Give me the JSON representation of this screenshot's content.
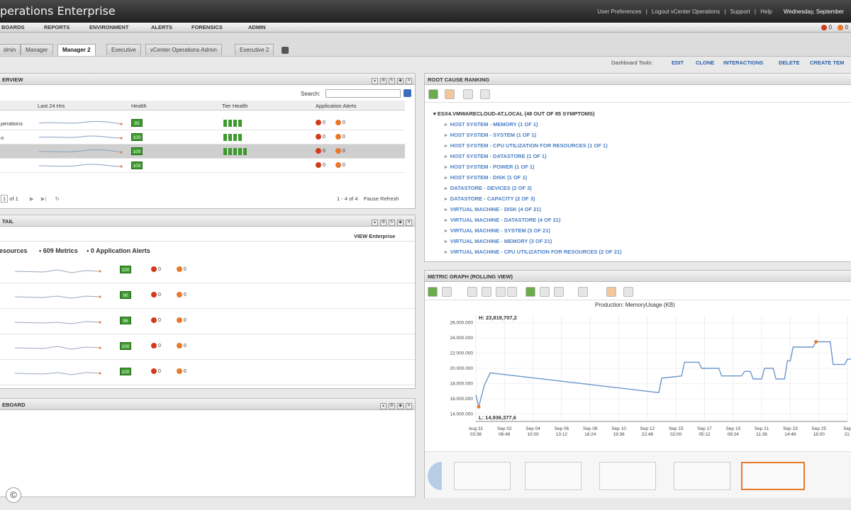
{
  "app_title": "perations Enterprise",
  "top_links": [
    "User Preferences",
    "|",
    "Logout vCenter Operations",
    "|",
    "Support",
    "|",
    "Help"
  ],
  "date_text": "Wednesday, September",
  "menu": [
    "BOARDS",
    "REPORTS",
    "ENVIRONMENT",
    "ALERTS",
    "FORENSICS",
    "ADMIN"
  ],
  "alert_counts": {
    "red": "0",
    "orange": "0"
  },
  "tabs": [
    {
      "label": "dmin",
      "active": false
    },
    {
      "label": "Manager",
      "active": false
    },
    {
      "label": "Manager 2",
      "active": true
    },
    {
      "label": "Executive",
      "active": false
    },
    {
      "label": "vCenter Operations Admin",
      "active": false
    },
    {
      "label": "Executive 2",
      "active": false
    }
  ],
  "dashboard_tools": {
    "label": "Dashboard Tools:",
    "links": [
      "EDIT",
      "CLONE",
      "INTERACTIONS",
      "DELETE",
      "CREATE TEM"
    ]
  },
  "overview": {
    "title": "ERVIEW",
    "search_label": "Search:",
    "search_value": "",
    "columns": [
      "Last 24 Hrs",
      "Health",
      "Tier Health",
      "Application Alerts"
    ],
    "rows": [
      {
        "name": "perations",
        "health": "93",
        "tiers": 4,
        "red": "0",
        "orange": "0",
        "selected": false
      },
      {
        "name": "o",
        "health": "100",
        "tiers": 4,
        "red": "0",
        "orange": "0",
        "selected": false
      },
      {
        "name": "",
        "health": "100",
        "tiers": 5,
        "red": "0",
        "orange": "0",
        "selected": true
      },
      {
        "name": "",
        "health": "100",
        "tiers": 0,
        "red": "0",
        "orange": "0",
        "selected": false
      }
    ],
    "pager": {
      "page": "1",
      "of": "of 1",
      "range": "1 - 4 of 4",
      "pause": "Pause Refresh"
    }
  },
  "detail": {
    "title": "TAIL",
    "subtitle": "VIEW Enterprise",
    "summary": [
      "esources",
      "• 609 Metrics",
      "• 0 Application Alerts"
    ],
    "rows": [
      {
        "health": "100",
        "red": "0",
        "orange": "0"
      },
      {
        "health": "90",
        "red": "0",
        "orange": "0"
      },
      {
        "health": "96",
        "red": "0",
        "orange": "0"
      },
      {
        "health": "100",
        "red": "0",
        "orange": "0"
      },
      {
        "health": "100",
        "red": "0",
        "orange": "0"
      }
    ]
  },
  "scoreboard": {
    "title": "EBOARD"
  },
  "root_cause": {
    "title": "ROOT CAUSE RANKING",
    "root": "ESX4.VMWARECLOUD-AT.LOCAL   (48 OUT OF 85 SYMPTOMS)",
    "symptoms": [
      "HOST SYSTEM - MEMORY   (1 OF 1)",
      "HOST SYSTEM - SYSTEM   (1 OF 1)",
      "HOST SYSTEM - CPU UTILIZATION FOR RESOURCES   (1 OF 1)",
      "HOST SYSTEM - DATASTORE   (1 OF 1)",
      "HOST SYSTEM - POWER   (1 OF 1)",
      "HOST SYSTEM - DISK   (1 OF 1)",
      "DATASTORE - DEVICES   (2 OF 3)",
      "DATASTORE - CAPACITY   (2 OF 3)",
      "VIRTUAL MACHINE - DISK   (4 OF 21)",
      "VIRTUAL MACHINE - DATASTORE   (4 OF 21)",
      "VIRTUAL MACHINE - SYSTEM   (3 OF 21)",
      "VIRTUAL MACHINE - MEMORY   (3 OF 21)",
      "VIRTUAL MACHINE - CPU UTILIZATION FOR RESOURCES   (2 OF 21)"
    ]
  },
  "metric_graph": {
    "title": "METRIC GRAPH (ROLLING VIEW)",
    "chart_title": "Production: MemoryUsage (KB)",
    "max_label": "H: 23,819,707,2",
    "min_label": "L: 14,936,377,6"
  },
  "chart_data": {
    "type": "line",
    "title": "Production: MemoryUsage (KB)",
    "y_ticks": [
      "26.000.000",
      "24.000.000",
      "22.000.000",
      "20.000.000",
      "18.000.000",
      "16.000.000",
      "14.000.000"
    ],
    "ylim": [
      13000000,
      27000000
    ],
    "x_ticks": [
      [
        "Aug 31",
        "03:36"
      ],
      [
        "Sep 02",
        "06:48"
      ],
      [
        "Sep 04",
        "10:00"
      ],
      [
        "Sep 06",
        "13:12"
      ],
      [
        "Sep 08",
        "16:24"
      ],
      [
        "Sep 10",
        "19:36"
      ],
      [
        "Sep 12",
        "22:48"
      ],
      [
        "Sep 15",
        "02:00"
      ],
      [
        "Sep 17",
        "05:12"
      ],
      [
        "Sep 19",
        "08:24"
      ],
      [
        "Sep 21",
        "11:36"
      ],
      [
        "Sep 23",
        "14:48"
      ],
      [
        "Sep 25",
        "18:00"
      ],
      [
        "Sep",
        "21:"
      ]
    ],
    "series": [
      {
        "values": [
          [
            0.0,
            16500000
          ],
          [
            0.1,
            14936377
          ],
          [
            0.3,
            17800000
          ],
          [
            0.5,
            19400000
          ],
          [
            3.0,
            18300000
          ],
          [
            6.4,
            16800000
          ],
          [
            6.5,
            18700000
          ],
          [
            7.2,
            19000000
          ],
          [
            7.3,
            20800000
          ],
          [
            7.8,
            20800000
          ],
          [
            7.9,
            20000000
          ],
          [
            8.5,
            20000000
          ],
          [
            8.6,
            19000000
          ],
          [
            9.3,
            19000000
          ],
          [
            9.4,
            19600000
          ],
          [
            9.6,
            19600000
          ],
          [
            9.7,
            18600000
          ],
          [
            10.0,
            18600000
          ],
          [
            10.1,
            20000000
          ],
          [
            10.4,
            20000000
          ],
          [
            10.5,
            18600000
          ],
          [
            10.8,
            18600000
          ],
          [
            10.9,
            21000000
          ],
          [
            11.0,
            21000000
          ],
          [
            11.1,
            22800000
          ],
          [
            11.8,
            22800000
          ],
          [
            11.9,
            23500000
          ],
          [
            12.4,
            23500000
          ],
          [
            12.5,
            20500000
          ],
          [
            12.9,
            20500000
          ],
          [
            13.0,
            21200000
          ],
          [
            13.3,
            21200000
          ],
          [
            13.4,
            20500000
          ],
          [
            13.6,
            20500000
          ],
          [
            13.7,
            23000000
          ],
          [
            14.0,
            23000000
          ],
          [
            14.1,
            21200000
          ],
          [
            14.5,
            21200000
          ],
          [
            14.6,
            20700000
          ],
          [
            14.8,
            20700000
          ],
          [
            14.9,
            22600000
          ],
          [
            15.1,
            22600000
          ],
          [
            15.2,
            21200000
          ],
          [
            15.6,
            21200000
          ],
          [
            15.7,
            23200000
          ],
          [
            15.9,
            23200000
          ],
          [
            16.0,
            20800000
          ],
          [
            16.2,
            20800000
          ],
          [
            16.3,
            23000000
          ],
          [
            16.5,
            23000000
          ],
          [
            16.6,
            21000000
          ],
          [
            17.0,
            21000000
          ],
          [
            17.1,
            23400000
          ],
          [
            20.0,
            21000000
          ]
        ]
      }
    ],
    "grid": true
  }
}
